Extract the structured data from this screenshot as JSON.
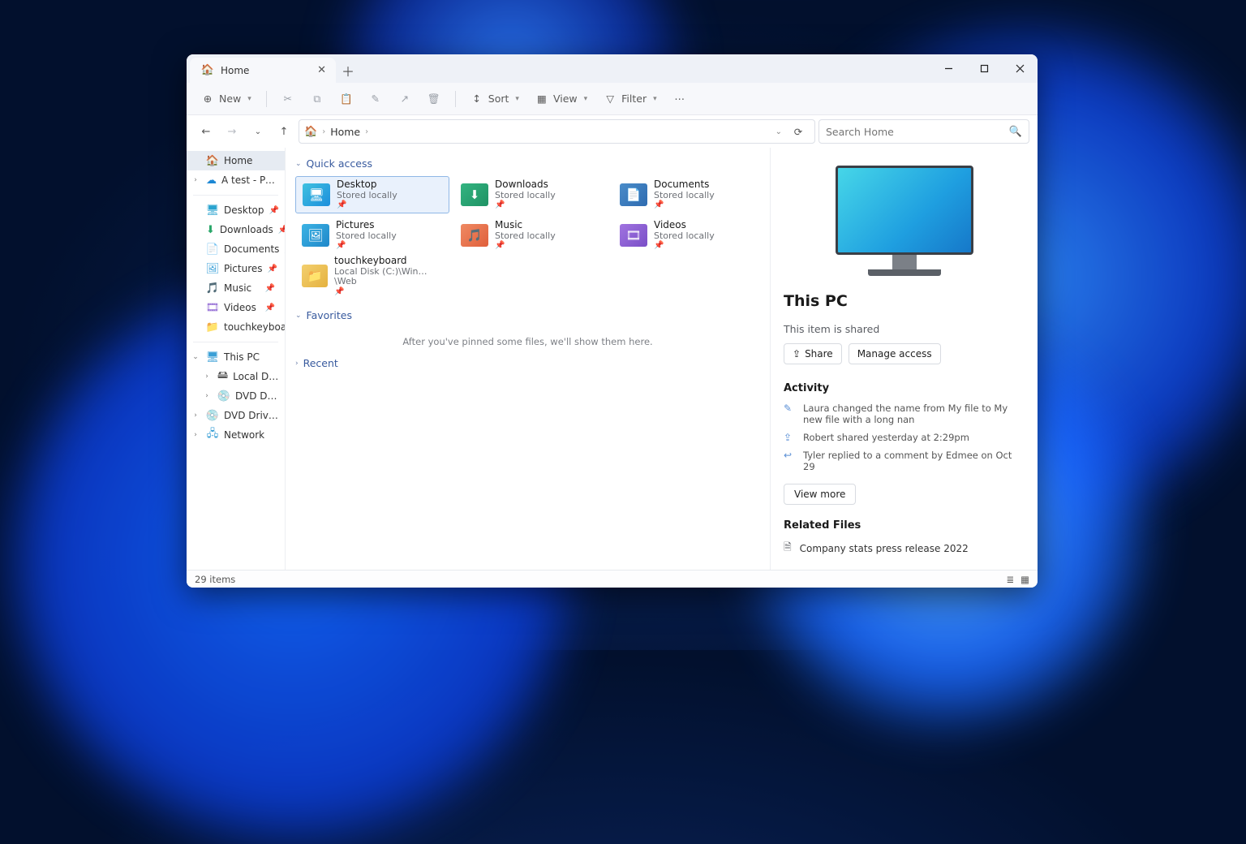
{
  "tab": {
    "title": "Home"
  },
  "toolbar": {
    "new": "New",
    "sort": "Sort",
    "view": "View",
    "filter": "Filter"
  },
  "address": {
    "crumb1": "Home"
  },
  "search": {
    "placeholder": "Search Home"
  },
  "sidebar": {
    "home": "Home",
    "atest": "A test - Personal",
    "desktop": "Desktop",
    "downloads": "Downloads",
    "documents": "Documents",
    "pictures": "Pictures",
    "music": "Music",
    "videos": "Videos",
    "touchkeyboard": "touchkeyboard",
    "thispc": "This PC",
    "localdisk": "Local Disk (C:)",
    "dvd1": "DVD Drive (D:) CC",
    "dvd2": "DVD Drive (D:) CCC",
    "network": "Network"
  },
  "sections": {
    "quick": "Quick access",
    "favorites": "Favorites",
    "favorites_empty": "After you've pinned some files, we'll show them here.",
    "recent": "Recent"
  },
  "qa": {
    "desktop": {
      "name": "Desktop",
      "sub": "Stored locally"
    },
    "downloads": {
      "name": "Downloads",
      "sub": "Stored locally"
    },
    "documents": {
      "name": "Documents",
      "sub": "Stored locally"
    },
    "pictures": {
      "name": "Pictures",
      "sub": "Stored locally"
    },
    "music": {
      "name": "Music",
      "sub": "Stored locally"
    },
    "videos": {
      "name": "Videos",
      "sub": "Stored locally"
    },
    "touchkeyboard": {
      "name": "touchkeyboard",
      "sub": "Local Disk (C:)\\Win…\\Web"
    }
  },
  "details": {
    "title": "This PC",
    "shared": "This item is shared",
    "share_btn": "Share",
    "manage_btn": "Manage access",
    "activity_h": "Activity",
    "act1": "Laura changed the name from My file to My new file with a long nan",
    "act2": "Robert shared yesterday at 2:29pm",
    "act3": "Tyler replied to a comment by Edmee on Oct 29",
    "viewmore": "View more",
    "related_h": "Related Files",
    "related1": "Company stats press release 2022"
  },
  "status": {
    "items": "29 items"
  }
}
